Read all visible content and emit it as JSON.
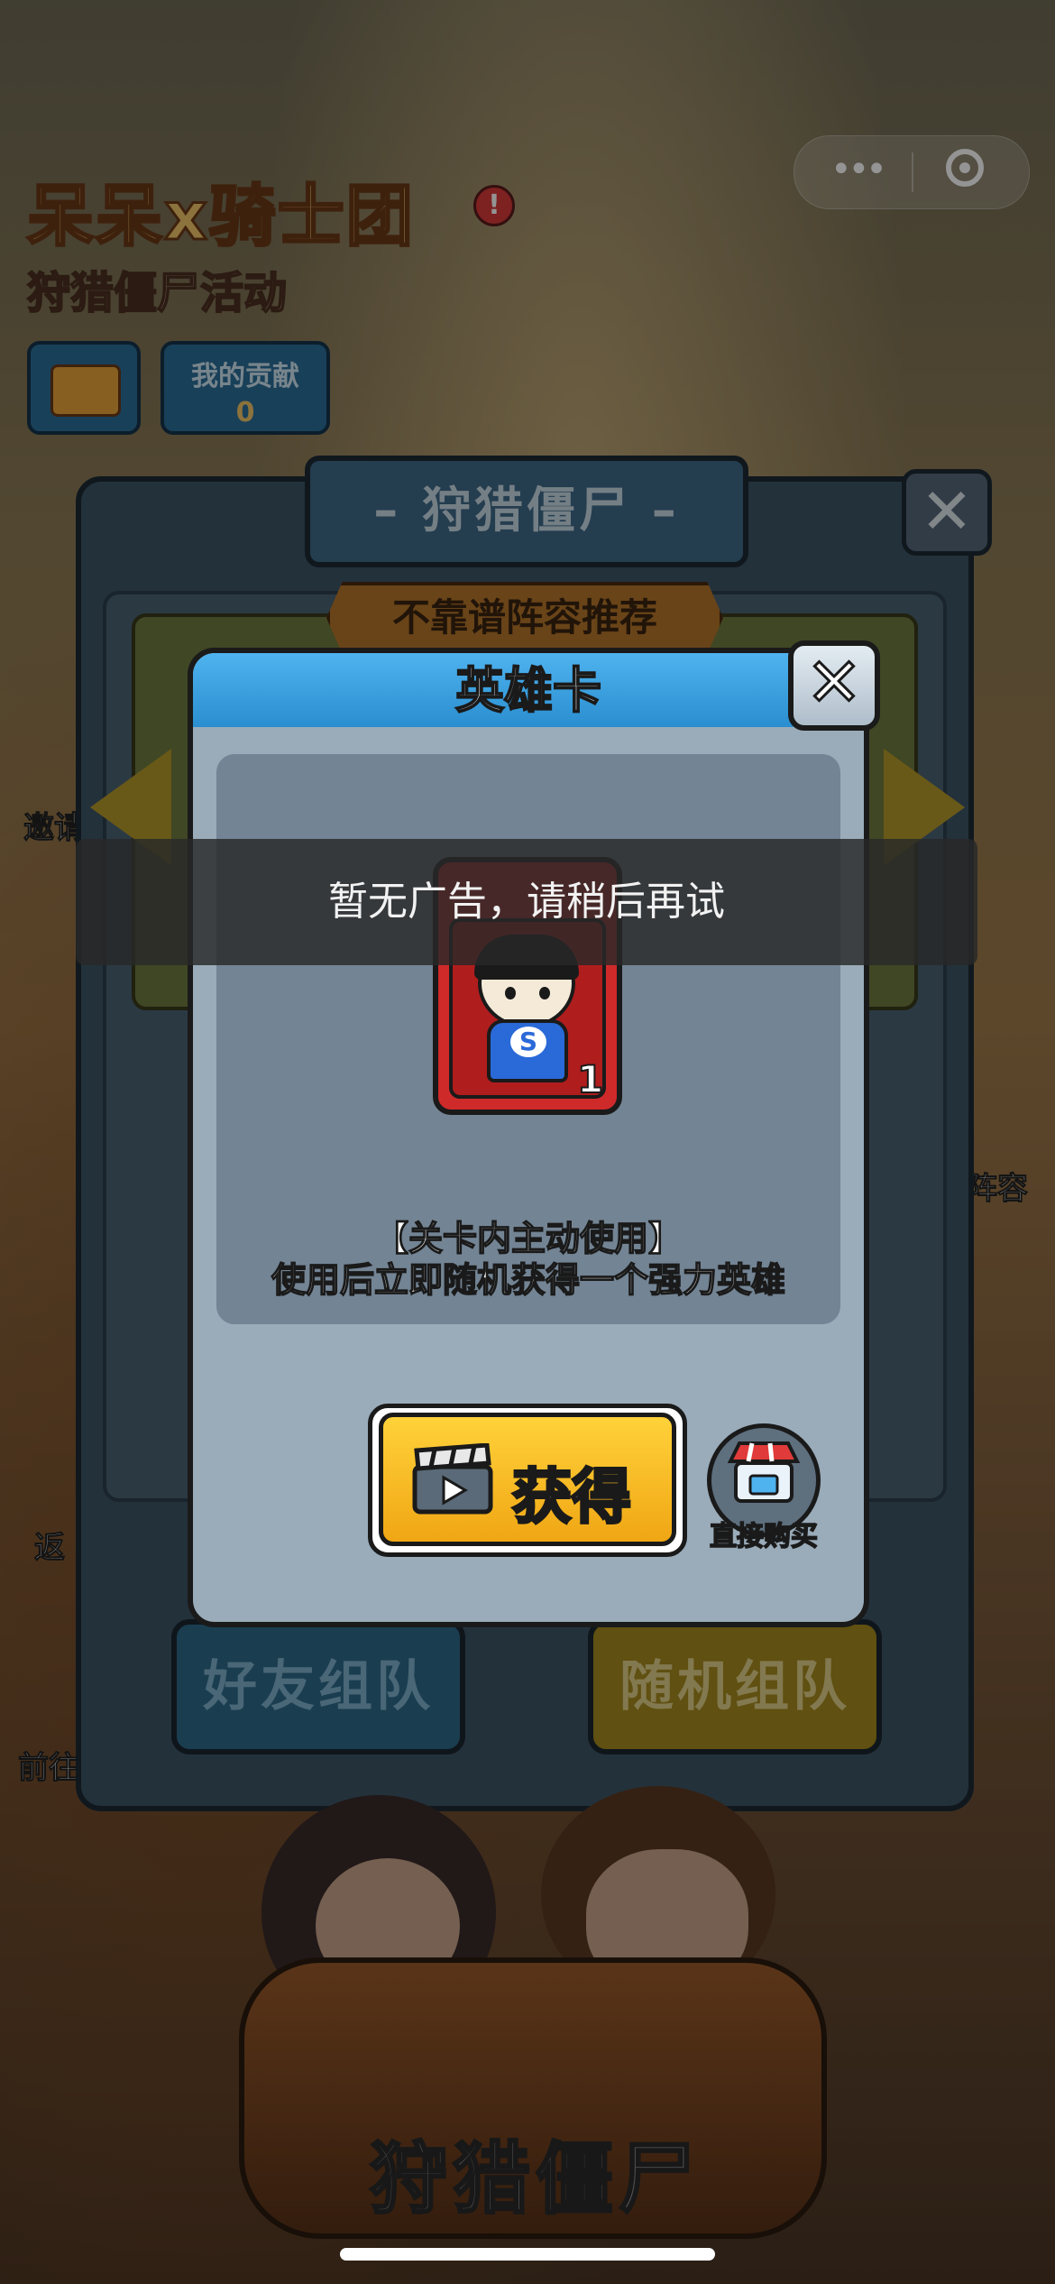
{
  "game": {
    "title": "呆呆x骑士团",
    "subtitle": "狩猎僵尸活动",
    "warn_mark": "!"
  },
  "capsule": {
    "more_label": "•••"
  },
  "contribution": {
    "label": "我的贡献",
    "value": "0"
  },
  "side_labels": {
    "left_invite": "邀请",
    "left_return": "返",
    "left_goto": "前往",
    "right_lineup": "阵容"
  },
  "hunt_panel": {
    "title": "– 狩猎僵尸 –",
    "close_label": "✕",
    "ribbon": "不靠谱阵容推荐",
    "friends_team_label": "好友组队",
    "random_team_label": "随机组队",
    "stage_title": "狩猎僵尸"
  },
  "hero_modal": {
    "title": "英雄卡",
    "close_label": "✕",
    "card_emblem": "S",
    "card_count": "1",
    "desc_line1": "【关卡内主动使用】",
    "desc_line2": "使用后立即随机获得一个强力英雄",
    "obtain_label": "获得",
    "shop_label": "直接购买"
  },
  "toast": {
    "message": "暂无广告，请稍后再试"
  },
  "colors": {
    "modal_header": "#2a8ed0",
    "obtain_button": "#f0a614",
    "card_red": "#cf2a2a",
    "shop_label": "#ffdc45"
  },
  "icons": {
    "more": "more-dots-icon",
    "close_target": "target-icon",
    "clapperboard": "clapperboard-icon",
    "shop": "shop-icon"
  }
}
